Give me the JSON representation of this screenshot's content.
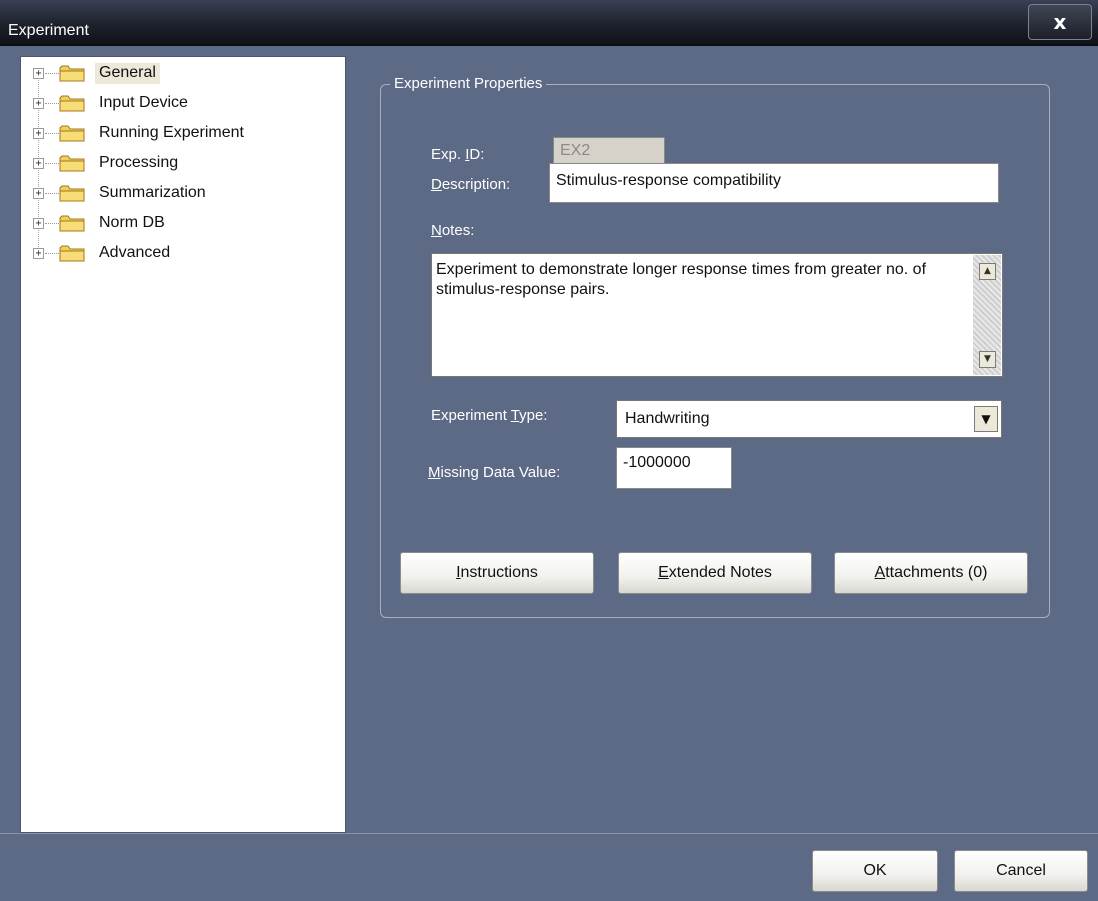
{
  "window": {
    "title": "Experiment",
    "close_glyph": "x"
  },
  "tree": {
    "items": [
      {
        "label": "General",
        "selected": true,
        "icon": "folder-icon"
      },
      {
        "label": "Input Device",
        "icon": "folder-icon"
      },
      {
        "label": "Running Experiment",
        "icon": "folder-icon"
      },
      {
        "label": "Processing",
        "icon": "folder-icon"
      },
      {
        "label": "Summarization",
        "icon": "folder-icon"
      },
      {
        "label": "Norm DB",
        "icon": "folder-icon"
      },
      {
        "label": "Advanced",
        "icon": "folder-icon"
      }
    ],
    "expander_glyph": "+"
  },
  "properties": {
    "group_title": "Experiment Properties",
    "exp_id_label_a": "Exp. ",
    "exp_id_label_u": "I",
    "exp_id_label_b": "D:",
    "exp_id_value": "EX2",
    "description_label_u": "D",
    "description_label_b": "escription:",
    "description_value": "Stimulus-response compatibility",
    "notes_label_u": "N",
    "notes_label_b": "otes:",
    "notes_value": "Experiment to demonstrate longer response times from greater no. of stimulus-response pairs.",
    "type_label_a": "Experiment ",
    "type_label_u": "T",
    "type_label_b": "ype:",
    "type_value": "Handwriting",
    "missing_label_u": "M",
    "missing_label_b": "issing Data Value:",
    "missing_value": "-1000000"
  },
  "buttons": {
    "instructions_u": "I",
    "instructions_b": "nstructions",
    "extended_u": "E",
    "extended_b": "xtended Notes",
    "attachments_u": "A",
    "attachments_b": "ttachments (0)",
    "ok": "OK",
    "cancel": "Cancel"
  },
  "colors": {
    "dialog_bg": "#5d6a86",
    "title_bg": "#1d212c",
    "selected_bg": "#ece9d8"
  }
}
